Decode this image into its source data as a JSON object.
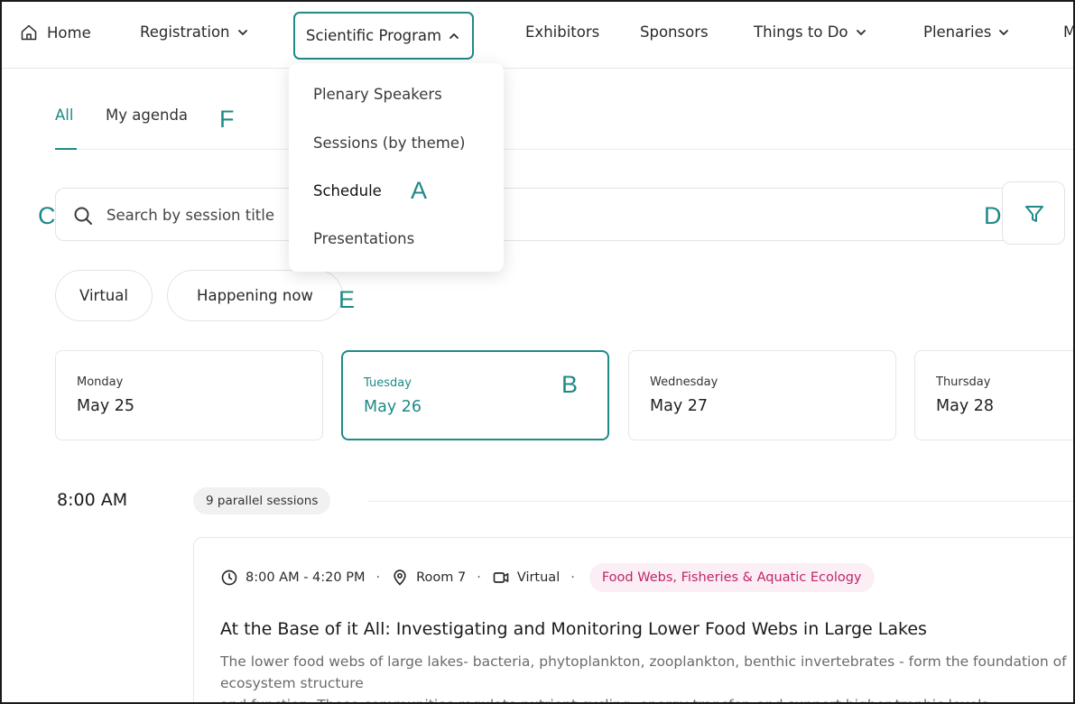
{
  "nav": {
    "items": [
      {
        "label": "Home"
      },
      {
        "label": "Registration"
      },
      {
        "label": "Scientific Program"
      },
      {
        "label": "Exhibitors"
      },
      {
        "label": "Sponsors"
      },
      {
        "label": "Things to Do"
      },
      {
        "label": "Plenaries"
      },
      {
        "label": "M"
      }
    ]
  },
  "dropdown": {
    "items": [
      {
        "label": "Plenary Speakers"
      },
      {
        "label": "Sessions (by theme)"
      },
      {
        "label": "Schedule"
      },
      {
        "label": "Presentations"
      }
    ]
  },
  "tabs": [
    {
      "label": "All"
    },
    {
      "label": "My agenda"
    }
  ],
  "search": {
    "placeholder": "Search by session title"
  },
  "chips": [
    {
      "label": "Virtual"
    },
    {
      "label": "Happening now"
    }
  ],
  "days": [
    {
      "name": "Monday",
      "date": "May 25"
    },
    {
      "name": "Tuesday",
      "date": "May 26"
    },
    {
      "name": "Wednesday",
      "date": "May 27"
    },
    {
      "name": "Thursday",
      "date": "May 28"
    }
  ],
  "timeslot": {
    "time": "8:00 AM",
    "parallel": "9 parallel sessions"
  },
  "session": {
    "time_range": "8:00 AM - 4:20 PM",
    "room": "Room 7",
    "mode": "Virtual",
    "theme": "Food Webs, Fisheries & Aquatic Ecology",
    "title": "At the Base of it All: Investigating and Monitoring Lower Food Webs in Large Lakes",
    "description": "The lower food webs of large lakes- bacteria, phytoplankton, zooplankton, benthic invertebrates - form the foundation of ecosystem structure\nand function. These communities regulate nutrient cycling, energy transfer, and support higher trophic levels"
  },
  "annotations": {
    "a": "A",
    "b": "B",
    "c": "C",
    "d": "D",
    "e": "E",
    "f": "F"
  },
  "colors": {
    "accent": "#1f8a86",
    "theme_badge_bg": "#fbeef4",
    "theme_badge_text": "#c0266a"
  },
  "icons": {
    "home": "home-icon",
    "chevron_down": "chevron-down-icon",
    "chevron_up": "chevron-up-icon",
    "search": "search-icon",
    "filter": "filter-icon",
    "clock": "clock-icon",
    "location": "location-pin-icon",
    "video": "video-camera-icon"
  }
}
